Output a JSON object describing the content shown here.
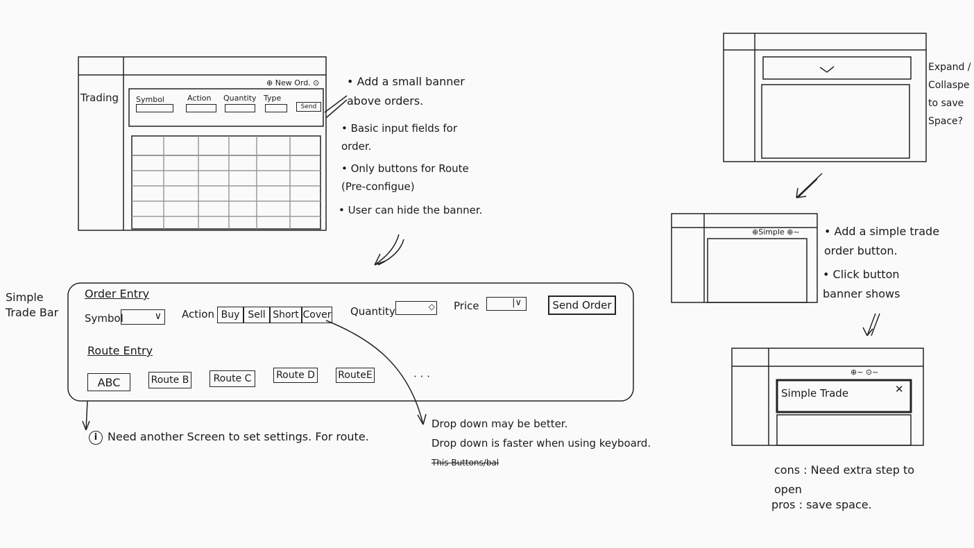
{
  "top_sketch": {
    "sidebar_label": "Trading",
    "new_order_label": "⊕ New Ord. ⊙",
    "fields": [
      "Symbol",
      "Action",
      "Quantity",
      "Type"
    ],
    "send_label": "Send"
  },
  "top_notes": [
    "• Add a small banner above orders.",
    "• Basic input fields for order.",
    "• Only buttons for Route (Pre-configue)",
    "• User can hide the banner."
  ],
  "trade_bar": {
    "side_label": "Simple Trade Bar",
    "order_entry_title": "Order Entry",
    "symbol_label": "Symbol",
    "action_label": "Action",
    "action_buttons": [
      "Buy",
      "Sell",
      "Short",
      "Cover"
    ],
    "quantity_label": "Quantity",
    "price_label": "Price",
    "send_order_label": "Send Order",
    "route_entry_title": "Route Entry",
    "route_buttons": [
      "ABC",
      "Route B",
      "Route C",
      "Route D",
      "RouteE"
    ],
    "ellipsis": "· · ·"
  },
  "bottom_notes": {
    "info_note": "Need another Screen to set settings. For route.",
    "dropdown_note_1": "Drop down may be better.",
    "dropdown_note_2": "Drop down is faster when using keyboard.",
    "strike_note": "This Buttons/bal"
  },
  "right_sketches": {
    "expand_note": "Expand / Collaspe to save Space?",
    "simple_label": "⊕Simple ⊕~",
    "add_button_note": "• Add a simple trade order button.",
    "click_note": "• Click button banner shows",
    "icons_label": "⊕~ ⊙~",
    "simple_trade_title": "Simple Trade",
    "close_glyph": "✕",
    "cons": "cons : Need extra step to open",
    "pros": "pros : save space."
  }
}
